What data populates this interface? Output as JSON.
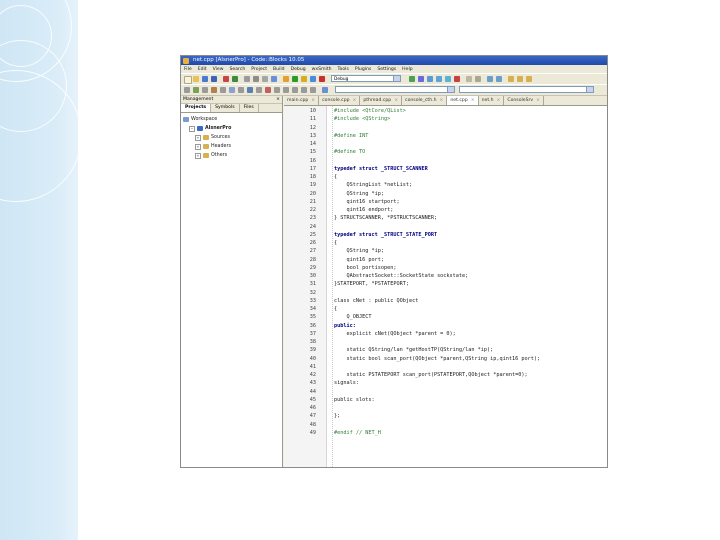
{
  "window": {
    "title": "net.cpp [AlsnerPro] - Code::Blocks 10.05"
  },
  "menu": [
    "File",
    "Edit",
    "View",
    "Search",
    "Project",
    "Build",
    "Debug",
    "wxSmith",
    "Tools",
    "Plugins",
    "Settings",
    "Help"
  ],
  "toolbar": {
    "build_target": "Debug",
    "search_combo": ""
  },
  "management": {
    "header": "Management",
    "close_glyph": "×",
    "tabs": [
      "Projects",
      "Symbols",
      "Files"
    ],
    "tree": [
      {
        "label": "Workspace",
        "level": 0,
        "expander": ""
      },
      {
        "label": "AlsnerPro",
        "level": 1,
        "expander": "−",
        "bold": true
      },
      {
        "label": "Sources",
        "level": 2,
        "expander": "+"
      },
      {
        "label": "Headers",
        "level": 2,
        "expander": "+"
      },
      {
        "label": "Others",
        "level": 2,
        "expander": "+"
      }
    ]
  },
  "editor": {
    "tabs": [
      {
        "label": "main.cpp",
        "active": false
      },
      {
        "label": "console.cpp",
        "active": false
      },
      {
        "label": "pthread.cpp",
        "active": false
      },
      {
        "label": "console_cth.h",
        "active": false
      },
      {
        "label": "net.cpp",
        "active": true
      },
      {
        "label": "net.h",
        "active": false
      },
      {
        "label": "ConsoleSrv",
        "active": false
      }
    ],
    "close_glyph": "×",
    "lines": [
      {
        "n": "10",
        "t": "#include <QtCore/QList>",
        "k": "pp"
      },
      {
        "n": "11",
        "t": "#include <QString>",
        "k": "pp"
      },
      {
        "n": "12",
        "t": "",
        "k": ""
      },
      {
        "n": "13",
        "t": "#define INT",
        "k": "pp"
      },
      {
        "n": "14",
        "t": "",
        "k": ""
      },
      {
        "n": "15",
        "t": "#define TO",
        "k": "pp"
      },
      {
        "n": "16",
        "t": "",
        "k": ""
      },
      {
        "n": "17",
        "t": "typedef struct _STRUCT_SCANNER",
        "k": "kw"
      },
      {
        "n": "18",
        "t": "{",
        "k": ""
      },
      {
        "n": "19",
        "t": "    QStringList *netList;",
        "k": ""
      },
      {
        "n": "20",
        "t": "    QString *ip;",
        "k": ""
      },
      {
        "n": "21",
        "t": "    qint16 startport;",
        "k": ""
      },
      {
        "n": "22",
        "t": "    qint16 endport;",
        "k": ""
      },
      {
        "n": "23",
        "t": "} STRUCTSCANNER, *PSTRUCTSCANNER;",
        "k": ""
      },
      {
        "n": "24",
        "t": "",
        "k": ""
      },
      {
        "n": "25",
        "t": "typedef struct _STRUCT_STATE_PORT",
        "k": "kw"
      },
      {
        "n": "26",
        "t": "{",
        "k": ""
      },
      {
        "n": "27",
        "t": "    QString *ip;",
        "k": ""
      },
      {
        "n": "28",
        "t": "    qint16 port;",
        "k": ""
      },
      {
        "n": "29",
        "t": "    bool portisopen;",
        "k": ""
      },
      {
        "n": "30",
        "t": "    QAbstractSocket::SocketState sockstate;",
        "k": ""
      },
      {
        "n": "31",
        "t": "}STATEPORT, *PSTATEPORT;",
        "k": ""
      },
      {
        "n": "32",
        "t": "",
        "k": ""
      },
      {
        "n": "33",
        "t": "class cNet : public QObject",
        "k": ""
      },
      {
        "n": "34",
        "t": "{",
        "k": ""
      },
      {
        "n": "35",
        "t": "    Q_OBJECT",
        "k": ""
      },
      {
        "n": "36",
        "t": "public:",
        "k": "kw"
      },
      {
        "n": "37",
        "t": "    explicit cNet(QObject *parent = 0);",
        "k": ""
      },
      {
        "n": "38",
        "t": "",
        "k": ""
      },
      {
        "n": "39",
        "t": "    static QString/lan *getHostTP(QString/lan *ip);",
        "k": ""
      },
      {
        "n": "40",
        "t": "    static bool scan_port(QObject *parent,QString ip,qint16 port);",
        "k": ""
      },
      {
        "n": "41",
        "t": "",
        "k": ""
      },
      {
        "n": "42",
        "t": "    static PSTATEPORT scan_port(PSTATEPORT,QObject *parent=0);",
        "k": ""
      },
      {
        "n": "43",
        "t": "signals:",
        "k": ""
      },
      {
        "n": "44",
        "t": "",
        "k": ""
      },
      {
        "n": "45",
        "t": "public slots:",
        "k": ""
      },
      {
        "n": "46",
        "t": "",
        "k": ""
      },
      {
        "n": "47",
        "t": "};",
        "k": ""
      },
      {
        "n": "48",
        "t": "",
        "k": ""
      },
      {
        "n": "49",
        "t": "#endif // NET_H",
        "k": "pp"
      }
    ]
  },
  "colors": {
    "background_band": "#cfe6f5",
    "titlebar": "#1f4aa8"
  }
}
